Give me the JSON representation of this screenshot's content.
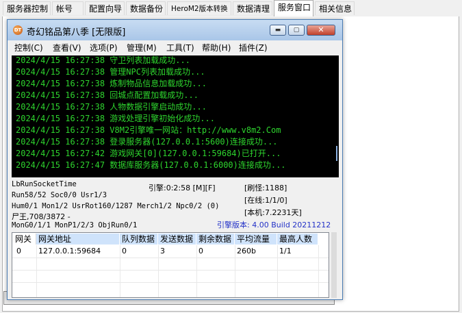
{
  "tabs": [
    "服务器控制",
    "帐号",
    "配置向导",
    "数据备份",
    "HeroM2版本转换",
    "数据清理",
    "服务窗口",
    "相关信息"
  ],
  "active_tab_index": 6,
  "window": {
    "icon_text": "DT",
    "title": "奇幻铭品第八季 [无限版]",
    "min_label": "▬",
    "max_label": "▢",
    "close_label": "✕"
  },
  "menu": [
    "控制(C)",
    "查看(V)",
    "选项(P)",
    "管理(M)",
    "工具(T)",
    "帮助(H)",
    "插件(Z)"
  ],
  "log_color": "#2ed52e",
  "log": [
    "2024/4/15 16:27:38 守卫列表加载成功...",
    "2024/4/15 16:27:38 管理NPC列表加载成功...",
    "2024/4/15 16:27:38 炼制物品信息加载成功...",
    "2024/4/15 16:27:38 回城点配置加载成功...",
    "2024/4/15 16:27:38 人物数据引擎启动成功...",
    "2024/4/15 16:27:38 游戏处理引擎初始化成功...",
    "2024/4/15 16:27:38 V8M2引擎唯一网站：http://www.v8m2.Com",
    "2024/4/15 16:27:38 登录服务器(127.0.0.1:5600)连接成功...",
    "2024/4/15 16:27:42 游戏网关[0](127.0.0.1:59684)已打开...",
    "2024/4/15 16:27:47 数据库服务器(127.0.0.1:6000)连接成功..."
  ],
  "status": {
    "socket": "LbRunSocketTime",
    "engine_time": "引擎:0:2:58 [M][F]",
    "refresh": "[刷怪:1188]",
    "run": "Run58/52 Soc0/0 Usr1/3",
    "online": "[在线:1/1/0]",
    "hum": "Hum0/1 Mon1/2 UsrRot160/1287 Merch1/2 Npc0/2 (0)",
    "machine": "[本机:7.2231天]",
    "corpse": "尸王,708/3872 -",
    "mon": "MonG0/1/1 MonP1/2/3 ObjRun0/1",
    "version": "引擎版本: 4.00 Build 20211212"
  },
  "grid": {
    "headers": [
      "网关",
      "网关地址",
      "队列数据",
      "发送数据",
      "剩余数据",
      "平均流量",
      "最高人数"
    ],
    "rows": [
      [
        "0",
        "127.0.0.1:59684",
        "0",
        "3",
        "0",
        "260b",
        "1/1"
      ]
    ]
  }
}
